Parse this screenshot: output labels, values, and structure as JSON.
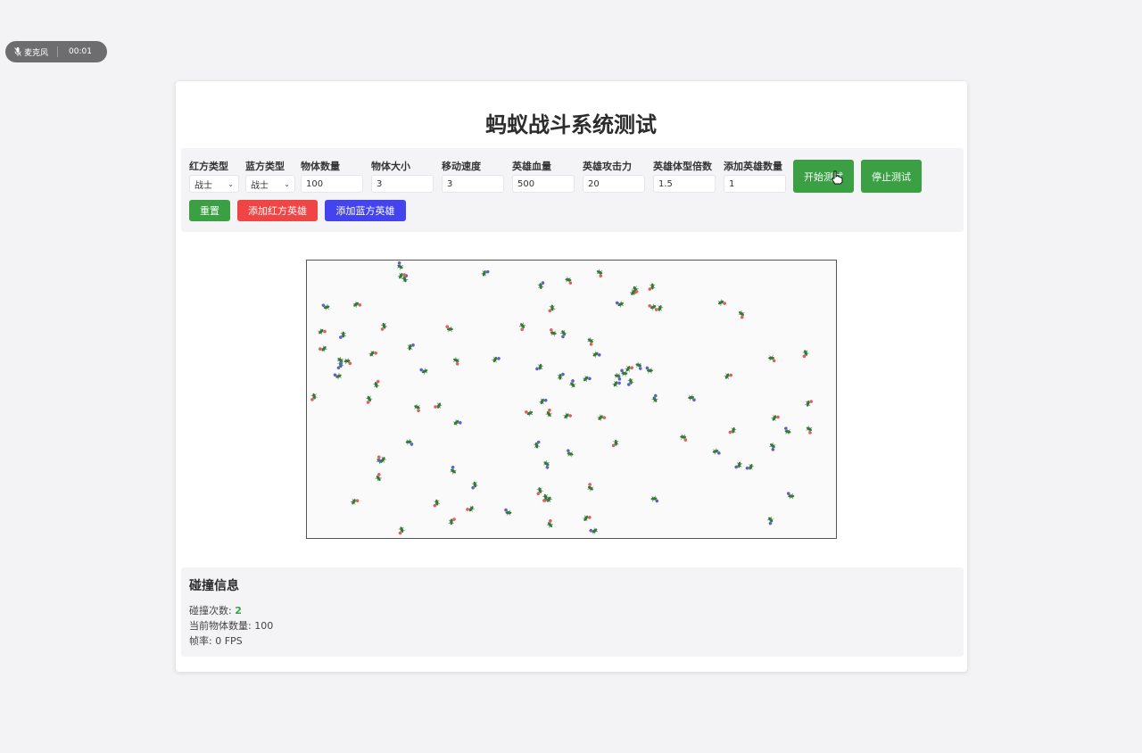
{
  "recorder": {
    "label": "麦克风",
    "time": "00:01"
  },
  "title": "蚂蚁战斗系统测试",
  "controls": {
    "red_type": {
      "label": "红方类型",
      "value": "战士"
    },
    "blue_type": {
      "label": "蓝方类型",
      "value": "战士"
    },
    "count": {
      "label": "物体数量",
      "value": "100"
    },
    "size": {
      "label": "物体大小",
      "value": "3"
    },
    "speed": {
      "label": "移动速度",
      "value": "3"
    },
    "hero_hp": {
      "label": "英雄血量",
      "value": "500"
    },
    "hero_attack": {
      "label": "英雄攻击力",
      "value": "20"
    },
    "hero_scale": {
      "label": "英雄体型倍数",
      "value": "1.5"
    },
    "hero_add_count": {
      "label": "添加英雄数量",
      "value": "1"
    }
  },
  "buttons": {
    "start": "开始测试",
    "stop": "停止测试",
    "reset": "重置",
    "add_red": "添加红方英雄",
    "add_blue": "添加蓝方英雄"
  },
  "info": {
    "heading": "碰撞信息",
    "collisions_label": "碰撞次数: ",
    "collisions_value": "2",
    "objects_label": "当前物体数量: ",
    "objects_value": "100",
    "fps_label": "帧率: ",
    "fps_value": "0 FPS"
  },
  "colors": {
    "green": "#3aa043",
    "red": "#f04545",
    "blue": "#4444ee",
    "ant_green": "#2e7d32",
    "ant_red": "#e06060",
    "ant_blue": "#6060d0"
  }
}
